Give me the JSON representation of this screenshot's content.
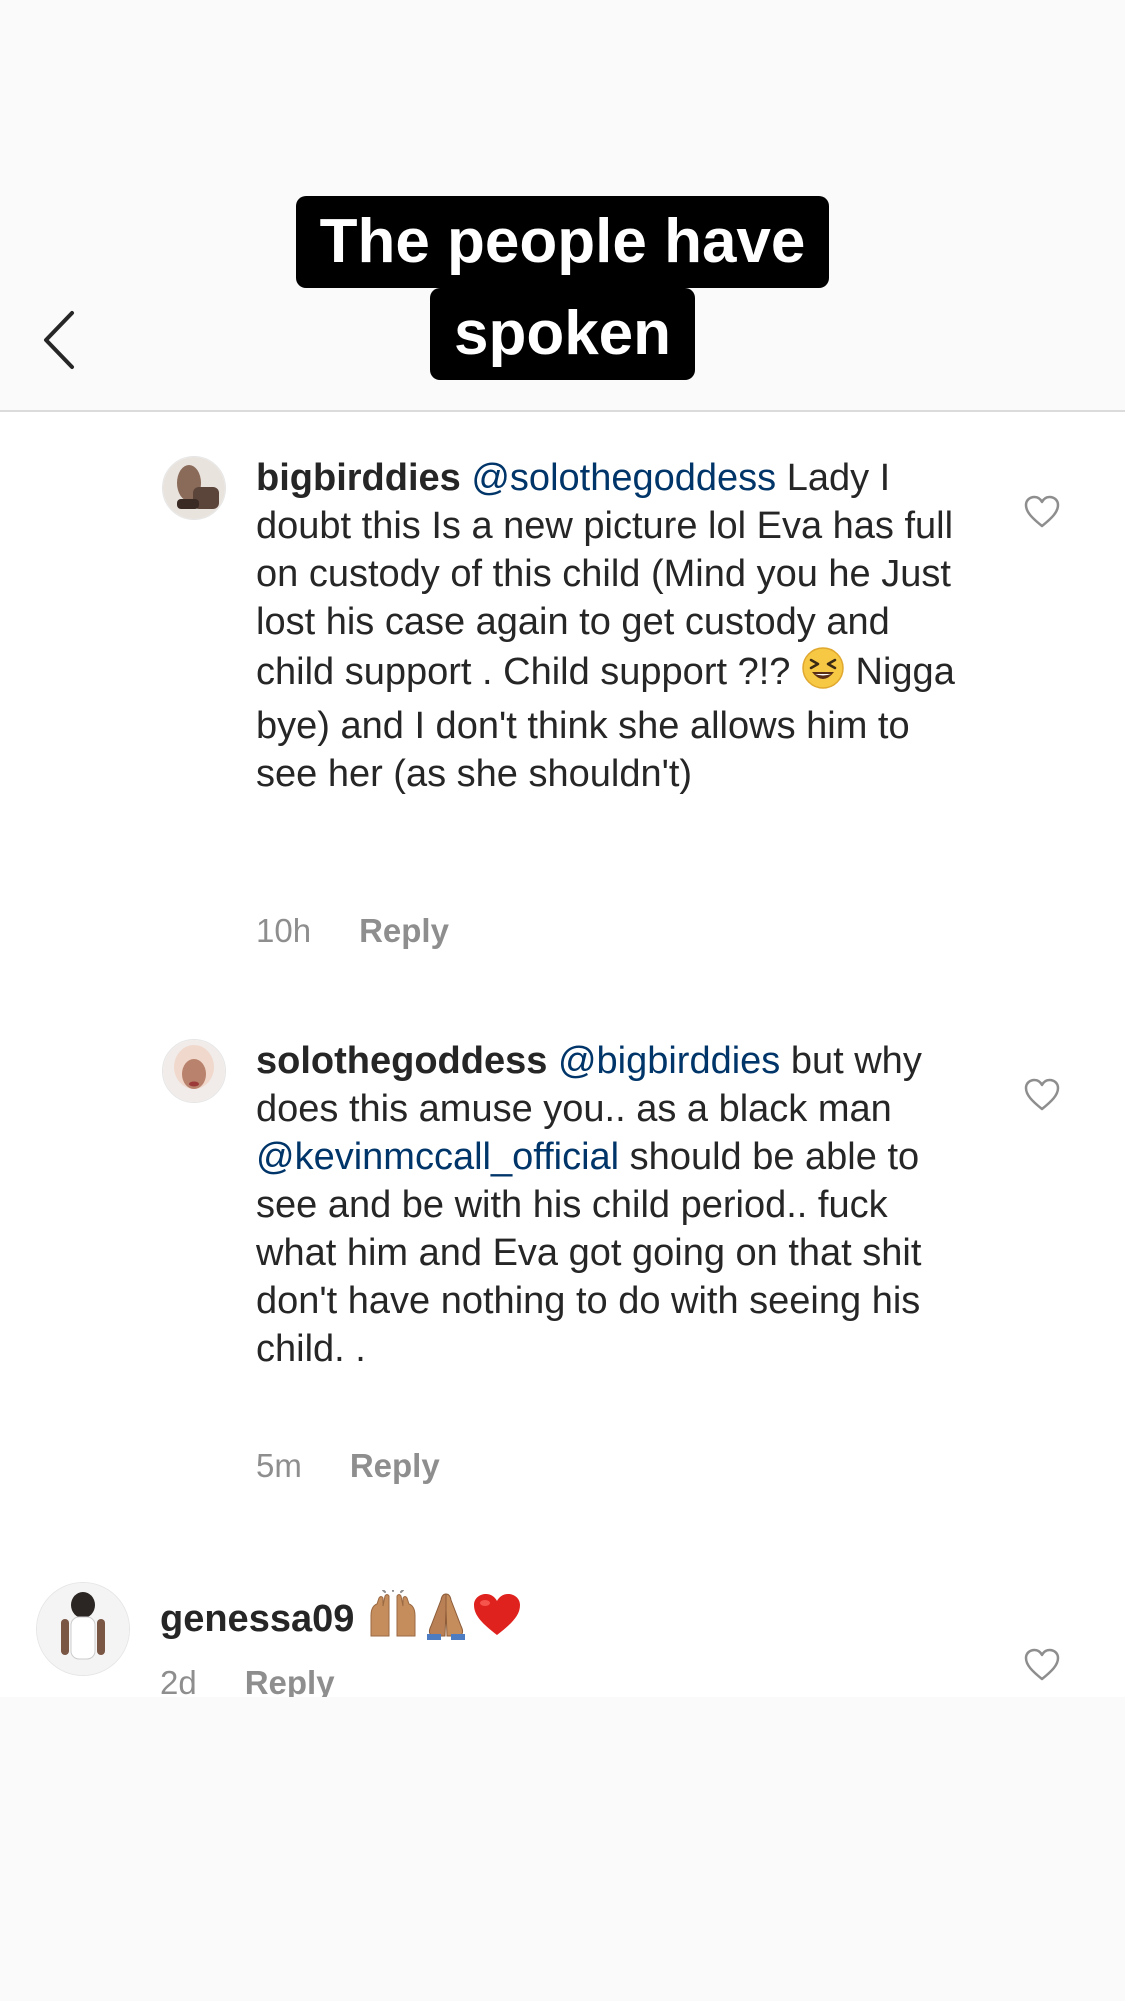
{
  "header": {
    "caption_line1": "The people have",
    "caption_line2": "spoken"
  },
  "comments": [
    {
      "username": "bigbirddies",
      "text_parts": [
        {
          "type": "mention",
          "text": "@solothegoddess"
        },
        {
          "type": "text",
          "text": " Lady I doubt this Is a new picture lol Eva has full on custody of this child (Mind you he Just lost his case again to get custody and child support . Child support ?!? "
        },
        {
          "type": "emoji",
          "name": "laughing-squint-emoji"
        },
        {
          "type": "text",
          "text": " Nigga bye) and I don't think she allows him to see her (as she shouldn't)"
        }
      ],
      "time": "10h",
      "reply_label": "Reply"
    },
    {
      "username": "solothegoddess",
      "text_parts": [
        {
          "type": "mention",
          "text": "@bigbirddies"
        },
        {
          "type": "text",
          "text": " but why does this amuse you.. as a black man "
        },
        {
          "type": "mention",
          "text": "@kevinmccall_official"
        },
        {
          "type": "text",
          "text": " should be able to see and be with his child period.. fuck what him and Eva got going on that shit don't have nothing to do with seeing his child. ."
        }
      ],
      "time": "5m",
      "reply_label": "Reply"
    },
    {
      "username": "genessa09",
      "emojis": [
        "raising-hands-emoji",
        "folded-hands-emoji",
        "red-heart-emoji"
      ],
      "time": "2d",
      "reply_label": "Reply"
    }
  ],
  "icons": {
    "back": "chevron-left-icon",
    "like": "heart-outline-icon"
  },
  "colors": {
    "mention": "#003569",
    "meta": "#8e8e8e",
    "caption_bg": "#000000"
  }
}
